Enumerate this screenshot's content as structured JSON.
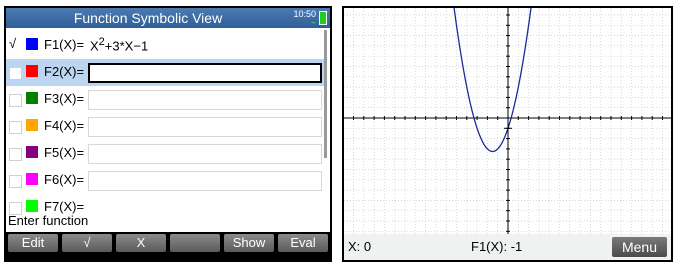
{
  "header": {
    "title": "Function Symbolic View",
    "time": "10:50"
  },
  "functions": [
    {
      "checked": true,
      "color": "#0000ff",
      "label": "F1(X)=",
      "expr_base": "X",
      "expr_sup": "2",
      "expr_rest": "+3*X−1"
    },
    {
      "checked": false,
      "color": "#ff0000",
      "label": "F2(X)="
    },
    {
      "checked": false,
      "color": "#008000",
      "label": "F3(X)="
    },
    {
      "checked": false,
      "color": "#ffa500",
      "label": "F4(X)="
    },
    {
      "checked": false,
      "color": "#800080",
      "label": "F5(X)="
    },
    {
      "checked": false,
      "color": "#ff00ff",
      "label": "F6(X)="
    },
    {
      "checked": false,
      "color": "#00ff00",
      "label": "F7(X)="
    }
  ],
  "check_mark": "√",
  "prompt": "Enter function",
  "softkeys": [
    "Edit",
    "√",
    "X",
    "",
    "Show",
    "Eval"
  ],
  "plot": {
    "function": "X^2+3*X-1",
    "curve_color": "#1a2a9a",
    "cursor": {
      "x_label": "X: 0",
      "f_label": "F1(X): -1"
    },
    "menu_label": "Menu"
  }
}
